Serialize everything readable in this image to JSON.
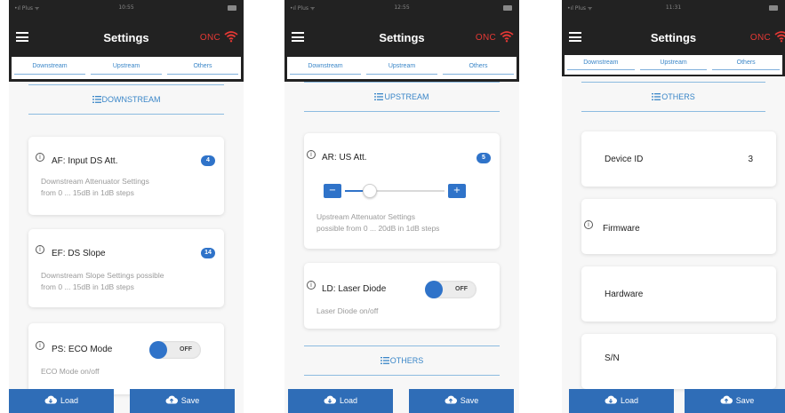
{
  "colors": {
    "accent": "#2f73c9",
    "onc_red": "#e53935",
    "navbar": "#222222",
    "tab_text": "#3a86c8"
  },
  "icons": [
    "menu-icon",
    "wifi-icon",
    "list-icon",
    "info-icon",
    "cloud-download-icon",
    "cloud-upload-icon"
  ],
  "screens": [
    {
      "status": {
        "carrier": "•ıl Plus ᯤ",
        "time": "10:55"
      },
      "title": "Settings",
      "onc": "ONC",
      "tabs": [
        "Downstream",
        "Upstream",
        "Others"
      ],
      "section": "DOWNSTREAM",
      "cards": [
        {
          "title": "AF: Input DS Att.",
          "value": "4",
          "desc1": "Downstream Attenuator Settings",
          "desc2": "from 0 ... 15dB in 1dB steps"
        },
        {
          "title": "EF: DS Slope",
          "value": "14",
          "desc1": "Downstream Slope Settings possible",
          "desc2": "from 0 ... 15dB in 1dB steps"
        },
        {
          "title": "PS: ECO Mode",
          "toggle": "OFF",
          "desc1": "ECO Mode on/off"
        }
      ],
      "load": "Load",
      "save": "Save"
    },
    {
      "status": {
        "carrier": "•ıl Plus ᯤ",
        "time": "12:55"
      },
      "title": "Settings",
      "onc": "ONC",
      "tabs": [
        "Downstream",
        "Upstream",
        "Others"
      ],
      "section": "UPSTREAM",
      "cards": [
        {
          "title": "AR: US Att.",
          "value": "5",
          "slider_fraction": 0.25,
          "minus": "−",
          "plus": "+",
          "desc1": "Upstream Attenuator Settings",
          "desc2": "possible from 0 ... 20dB in 1dB steps"
        },
        {
          "title": "LD: Laser Diode",
          "toggle": "OFF",
          "desc1": "Laser Diode on/off"
        }
      ],
      "section2": "OTHERS",
      "load": "Load",
      "save": "Save"
    },
    {
      "status": {
        "carrier": "•ıl Plus ᯤ",
        "time": "11:31"
      },
      "title": "Settings",
      "onc": "ONC",
      "tabs": [
        "Downstream",
        "Upstream",
        "Others"
      ],
      "section": "OTHERS",
      "rows": [
        {
          "label": "Device ID",
          "value": "3"
        },
        {
          "label": "Firmware",
          "value": ""
        },
        {
          "label": "Hardware",
          "value": ""
        },
        {
          "label": "S/N",
          "value": ""
        }
      ],
      "load": "Load",
      "save": "Save"
    }
  ]
}
